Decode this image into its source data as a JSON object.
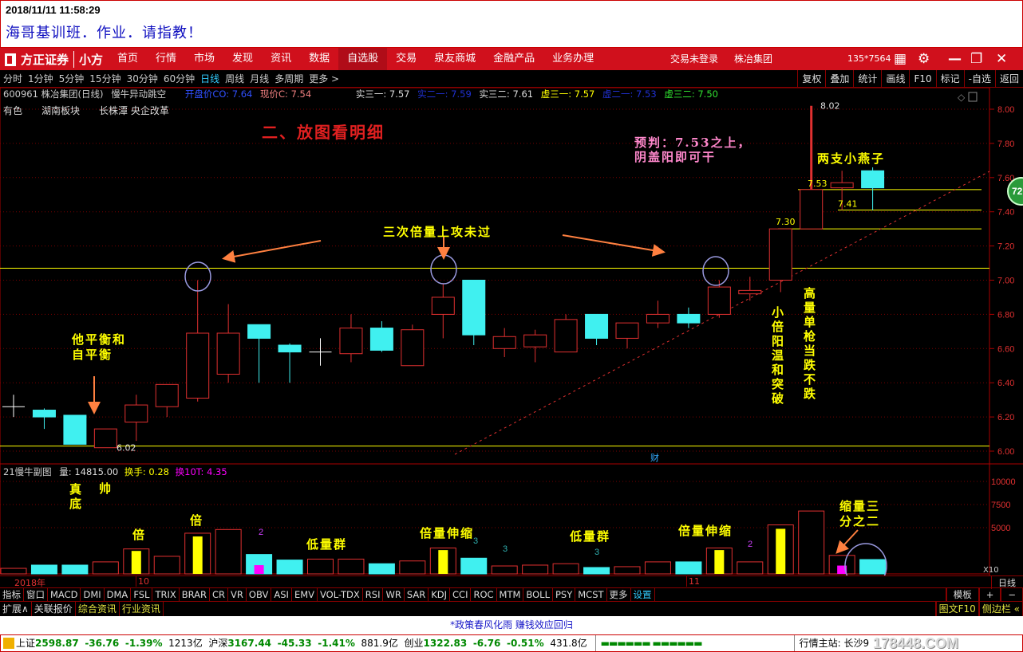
{
  "header": {
    "datetime": "2018/11/11 11:58:29",
    "post_title": "海哥基训班．作业．请指教！"
  },
  "menubar": {
    "logo": "方正证券",
    "logo_sub": "小方",
    "items": [
      "首页",
      "行情",
      "市场",
      "发现",
      "资讯",
      "数据",
      "自选股",
      "交易",
      "泉友商城",
      "金融产品",
      "业务办理"
    ],
    "active": "自选股",
    "login": "交易未登录",
    "stock": "株冶集团",
    "account": "135*7564"
  },
  "periods": {
    "items": [
      "分时",
      "1分钟",
      "5分钟",
      "15分钟",
      "30分钟",
      "60分钟",
      "日线",
      "周线",
      "月线",
      "多周期",
      "更多 >"
    ],
    "active": "日线",
    "right_buttons": [
      "复权",
      "叠加",
      "统计",
      "画线",
      "F10",
      "标记",
      "-自选",
      "返回"
    ]
  },
  "info": {
    "code_name": "600961 株冶集团(日线)",
    "indicator": "慢牛异动跳空",
    "open": "开盘价CO: 7.64",
    "close": "现价C: 7.54",
    "s31": "实三一: 7.57",
    "s21": "实二一: 7.59",
    "s32": "实三二: 7.61",
    "x31": "虚三一: 7.57",
    "x21": "虚二一: 7.53",
    "x32": "虚三二: 7.50",
    "tags": [
      "有色",
      "湖南板块",
      "长株潭 央企改革"
    ]
  },
  "colors": {
    "up": "#e03030",
    "down": "#40f0f0",
    "yellow": "#ffff00",
    "magenta": "#ff00ff",
    "menu": "#d0101c"
  },
  "chart_data": {
    "type": "candlestick",
    "ylim": [
      5.95,
      8.05
    ],
    "yticks": [
      "8.00",
      "7.80",
      "7.60",
      "7.40",
      "7.20",
      "7.00",
      "6.80",
      "6.60",
      "6.40",
      "6.20",
      "6.00"
    ],
    "candles": [
      [
        6.26,
        6.33,
        6.2,
        6.26
      ],
      [
        6.24,
        6.25,
        6.13,
        6.2
      ],
      [
        6.21,
        6.21,
        6.04,
        6.04
      ],
      [
        6.02,
        6.13,
        6.02,
        6.13
      ],
      [
        6.17,
        6.33,
        6.06,
        6.27
      ],
      [
        6.26,
        6.39,
        6.2,
        6.39
      ],
      [
        6.31,
        7.0,
        6.29,
        6.69
      ],
      [
        6.45,
        6.86,
        6.4,
        6.69
      ],
      [
        6.74,
        6.74,
        6.4,
        6.66
      ],
      [
        6.62,
        6.63,
        6.4,
        6.58
      ],
      [
        6.58,
        6.66,
        6.5,
        6.58
      ],
      [
        6.57,
        6.8,
        6.52,
        6.72
      ],
      [
        6.72,
        6.76,
        6.58,
        6.59
      ],
      [
        6.5,
        6.74,
        6.5,
        6.71
      ],
      [
        6.8,
        6.98,
        6.66,
        6.9
      ],
      [
        7.0,
        7.0,
        6.62,
        6.68
      ],
      [
        6.6,
        6.72,
        6.55,
        6.67
      ],
      [
        6.61,
        6.71,
        6.52,
        6.68
      ],
      [
        6.58,
        6.8,
        6.58,
        6.77
      ],
      [
        6.8,
        6.8,
        6.62,
        6.66
      ],
      [
        6.66,
        6.75,
        6.6,
        6.75
      ],
      [
        6.75,
        6.88,
        6.72,
        6.8
      ],
      [
        6.8,
        6.84,
        6.72,
        6.75
      ],
      [
        6.8,
        7.0,
        6.78,
        6.96
      ],
      [
        6.92,
        7.02,
        6.88,
        6.94
      ],
      [
        7.0,
        7.3,
        6.93,
        7.3
      ],
      [
        7.3,
        8.02,
        7.3,
        7.53
      ],
      [
        7.54,
        7.64,
        7.41,
        7.57
      ],
      [
        7.64,
        7.66,
        7.41,
        7.54
      ]
    ],
    "price_labels": {
      "high": "8.02",
      "low": "6.02",
      "l753": "7.53",
      "l741": "7.41",
      "l730": "7.30"
    },
    "volume": {
      "ylim": [
        0,
        11000
      ],
      "yticks": [
        "10000",
        "7500",
        "5000"
      ],
      "values": [
        600,
        950,
        950,
        1300,
        2700,
        1900,
        4400,
        4800,
        2100,
        1500,
        1600,
        1600,
        1100,
        1400,
        2800,
        1700,
        860,
        950,
        1100,
        690,
        780,
        1300,
        1300,
        2800,
        1300,
        5300,
        6800,
        2000,
        1550
      ],
      "markers": {
        "4": "yellow",
        "6": "yellow",
        "8": "magenta",
        "14": "yellow",
        "23": "yellow",
        "25": "yellow",
        "27": "magenta"
      },
      "unit": "X10"
    },
    "date_labels": [
      "2018年",
      "10",
      "11"
    ],
    "period_label": "日线",
    "cai": "财"
  },
  "annotations": {
    "a1": "二、放图看明细",
    "a2": "三次倍量上攻未过",
    "a3": "预判：7.53之上，",
    "a3b": "阴盖阳即可干",
    "a4": "两支小燕子",
    "a5": "他平衡和",
    "a5b": "自平衡",
    "a6": "小倍阳温和突破",
    "a7": "高量单枪当跌不跌",
    "v1": "真底",
    "v2": "帅",
    "v3": "倍",
    "v4": "倍",
    "v5": "低量群",
    "v6": "倍量伸缩",
    "v7": "低量群",
    "v8": "倍量伸缩",
    "v9": "缩量三",
    "v9b": "分之二",
    "n2a": "2",
    "n3a": "3",
    "n3b": "3",
    "n3c": "3",
    "n2b": "2",
    "badge": "72"
  },
  "volume_header": {
    "name": "21慢牛副图",
    "vol": "量: 14815.00",
    "turn": "换手: 0.28",
    "turn10": "换10T: 4.35"
  },
  "indicators": {
    "items": [
      "指标",
      "窗口",
      "MACD",
      "DMI",
      "DMA",
      "FSL",
      "TRIX",
      "BRAR",
      "CR",
      "VR",
      "OBV",
      "ASI",
      "EMV",
      "VOL-TDX",
      "RSI",
      "WR",
      "SAR",
      "KDJ",
      "CCI",
      "ROC",
      "MTM",
      "BOLL",
      "PSY",
      "MCST",
      "更多",
      "设置"
    ],
    "right": [
      "模板",
      "+",
      "−"
    ]
  },
  "ext": {
    "items": [
      "扩展∧",
      "关联报价",
      "综合资讯",
      "行业资讯"
    ],
    "right": [
      "图文F10",
      "侧边栏 «"
    ]
  },
  "news": "*政策春风化雨 赚钱效应回归",
  "status": {
    "sh": "上证",
    "sh_v": "2598.87",
    "sh_c": "-36.76",
    "sh_p": "-1.39%",
    "sh_a": "1213亿",
    "hs": "沪深",
    "hs_v": "3167.44",
    "hs_c": "-45.33",
    "hs_p": "-1.41%",
    "hs_a": "881.9亿",
    "cy": "创业",
    "cy_v": "1322.83",
    "cy_c": "-6.76",
    "cy_p": "-0.51%",
    "cy_a": "431.8亿",
    "server": "行情主站: 长沙9",
    "watermark": "178448.COM"
  }
}
